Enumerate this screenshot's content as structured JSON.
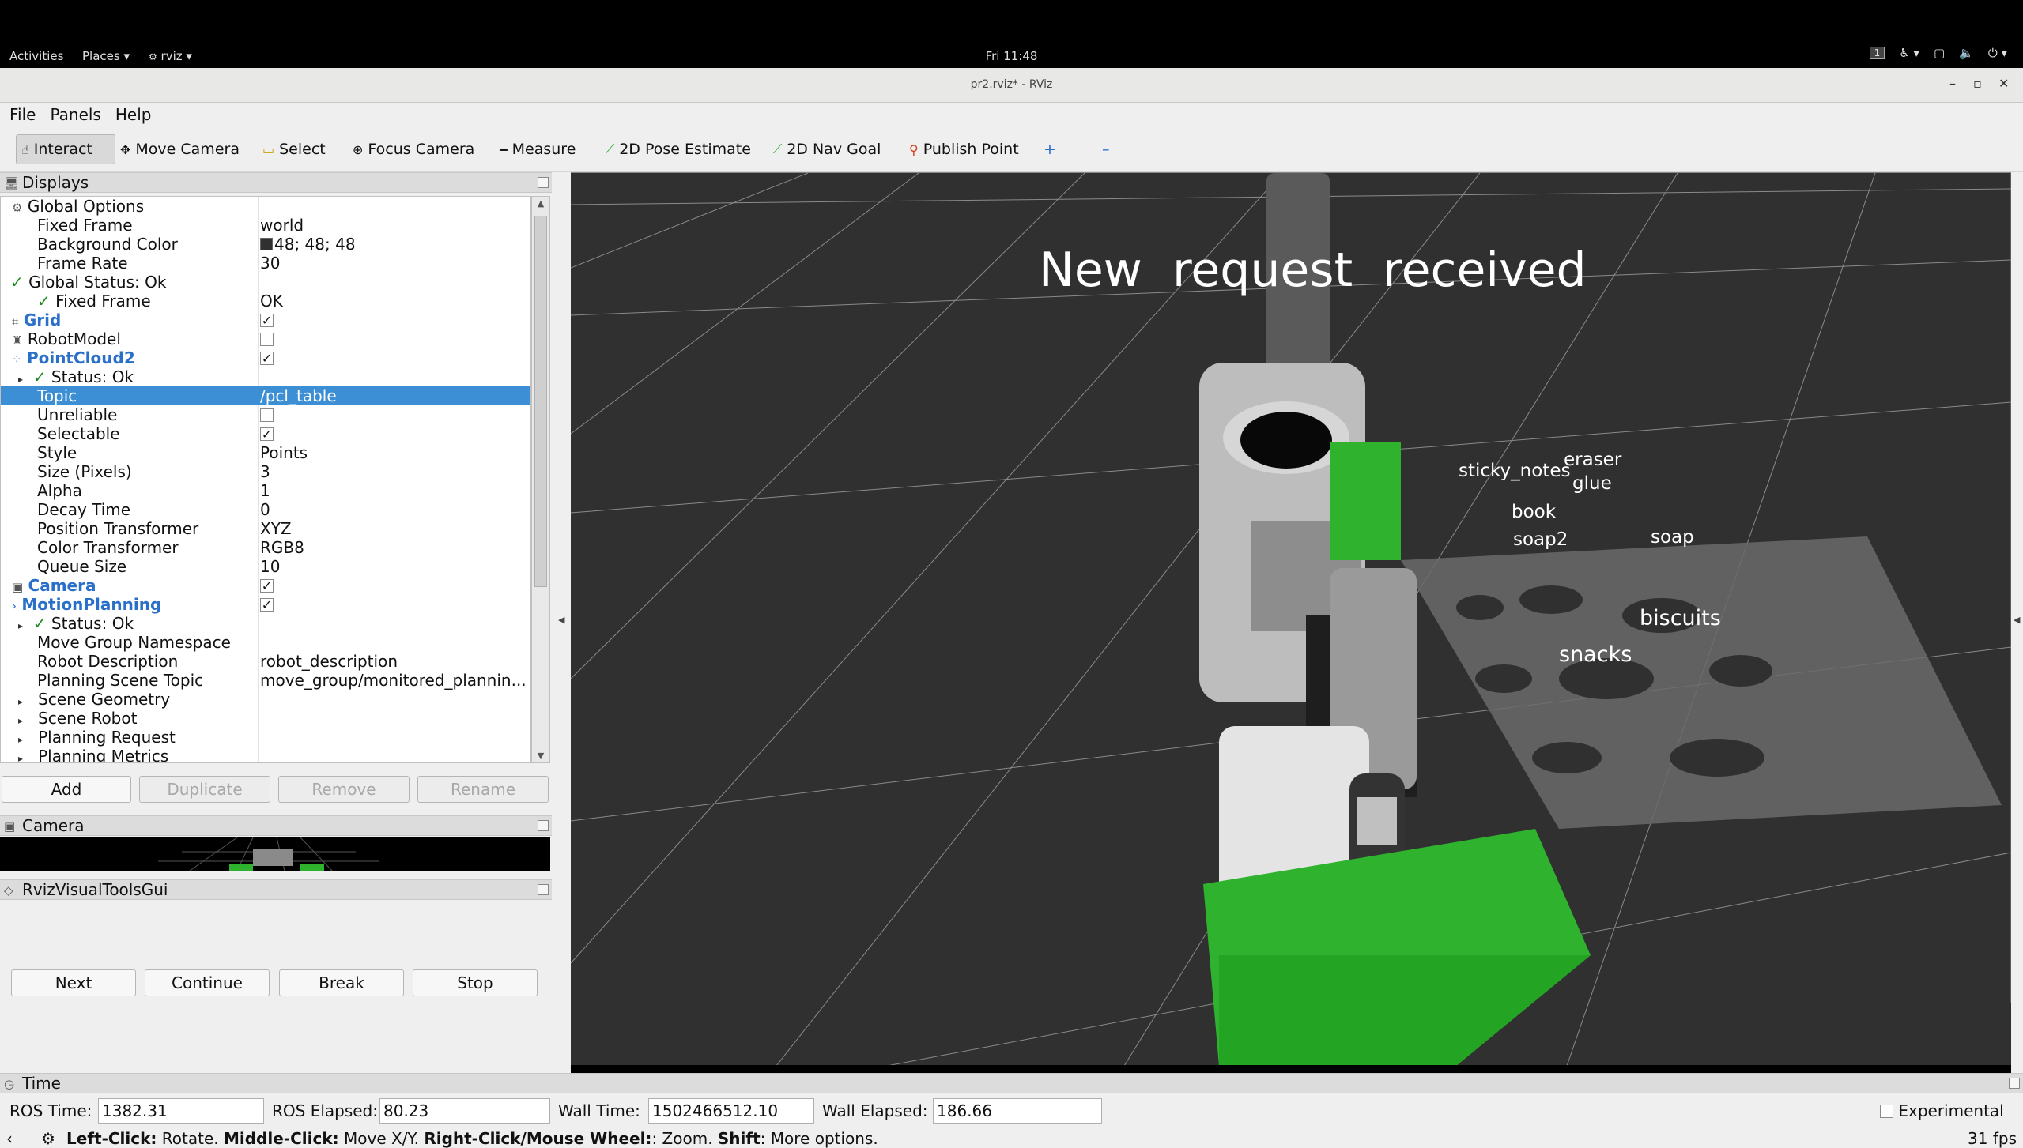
{
  "topbar": {
    "activities": "Activities",
    "places": "Places ▾",
    "app": "rviz ▾",
    "clock": "Fri 11:48",
    "workspace": "1"
  },
  "window": {
    "title": "pr2.rviz* - RViz",
    "minimize": "–",
    "maximize": "▫",
    "close": "✕"
  },
  "menu": {
    "file": "File",
    "panels": "Panels",
    "help": "Help"
  },
  "toolbar": {
    "interact": "Interact",
    "move_camera": "Move Camera",
    "select": "Select",
    "focus_camera": "Focus Camera",
    "measure": "Measure",
    "pose_estimate": "2D Pose Estimate",
    "nav_goal": "2D Nav Goal",
    "publish_point": "Publish Point",
    "plus": "+",
    "minus": "–"
  },
  "displays": {
    "title": "Displays",
    "rows": [
      {
        "label": "Global Options",
        "value": ""
      },
      {
        "label": "Fixed Frame",
        "value": "world"
      },
      {
        "label": "Background Color",
        "value": "48; 48; 48"
      },
      {
        "label": "Frame Rate",
        "value": "30"
      },
      {
        "label": "Global Status: Ok",
        "value": ""
      },
      {
        "label": "Fixed Frame",
        "value": "OK"
      },
      {
        "label": "Grid",
        "value": ""
      },
      {
        "label": "RobotModel",
        "value": ""
      },
      {
        "label": "PointCloud2",
        "value": ""
      },
      {
        "label": "Status: Ok",
        "value": ""
      },
      {
        "label": "Topic",
        "value": "/pcl_table"
      },
      {
        "label": "Unreliable",
        "value": ""
      },
      {
        "label": "Selectable",
        "value": ""
      },
      {
        "label": "Style",
        "value": "Points"
      },
      {
        "label": "Size (Pixels)",
        "value": "3"
      },
      {
        "label": "Alpha",
        "value": "1"
      },
      {
        "label": "Decay Time",
        "value": "0"
      },
      {
        "label": "Position Transformer",
        "value": "XYZ"
      },
      {
        "label": "Color Transformer",
        "value": "RGB8"
      },
      {
        "label": "Queue Size",
        "value": "10"
      },
      {
        "label": "Camera",
        "value": ""
      },
      {
        "label": "MotionPlanning",
        "value": ""
      },
      {
        "label": "Status: Ok",
        "value": ""
      },
      {
        "label": "Move Group Namespace",
        "value": ""
      },
      {
        "label": "Robot Description",
        "value": "robot_description"
      },
      {
        "label": "Planning Scene Topic",
        "value": "move_group/monitored_plannin..."
      },
      {
        "label": "Scene Geometry",
        "value": ""
      },
      {
        "label": "Scene Robot",
        "value": ""
      },
      {
        "label": "Planning Request",
        "value": ""
      },
      {
        "label": "Planning Metrics",
        "value": ""
      }
    ],
    "buttons": {
      "add": "Add",
      "duplicate": "Duplicate",
      "remove": "Remove",
      "rename": "Rename"
    }
  },
  "camera_panel": {
    "title": "Camera"
  },
  "visual_tools": {
    "title": "RvizVisualToolsGui",
    "next": "Next",
    "continue": "Continue",
    "break": "Break",
    "stop": "Stop"
  },
  "viewport": {
    "headline": "New  request  received",
    "labels": {
      "sticky_notes": "sticky_notes",
      "eraser": "eraser",
      "glue": "glue",
      "book": "book",
      "soap2": "soap2",
      "soap": "soap",
      "biscuits": "biscuits",
      "snacks": "snacks"
    },
    "background_color": "#303030",
    "box_color": "#2fb32f"
  },
  "time_panel": {
    "title": "Time",
    "ros_time_label": "ROS Time:",
    "ros_time": "1382.31",
    "ros_elapsed_label": "ROS Elapsed:",
    "ros_elapsed": "80.23",
    "wall_time_label": "Wall Time:",
    "wall_time": "1502466512.10",
    "wall_elapsed_label": "Wall Elapsed:",
    "wall_elapsed": "186.66",
    "experimental": "Experimental"
  },
  "status_bar": {
    "left_click": "Left-Click:",
    "rotate": " Rotate. ",
    "middle_click": "Middle-Click:",
    "move_xy": " Move X/Y. ",
    "right_click": "Right-Click/Mouse Wheel:",
    "zoom": ": Zoom. ",
    "shift": "Shift",
    "more": ": More options.",
    "fps": "31 fps"
  }
}
